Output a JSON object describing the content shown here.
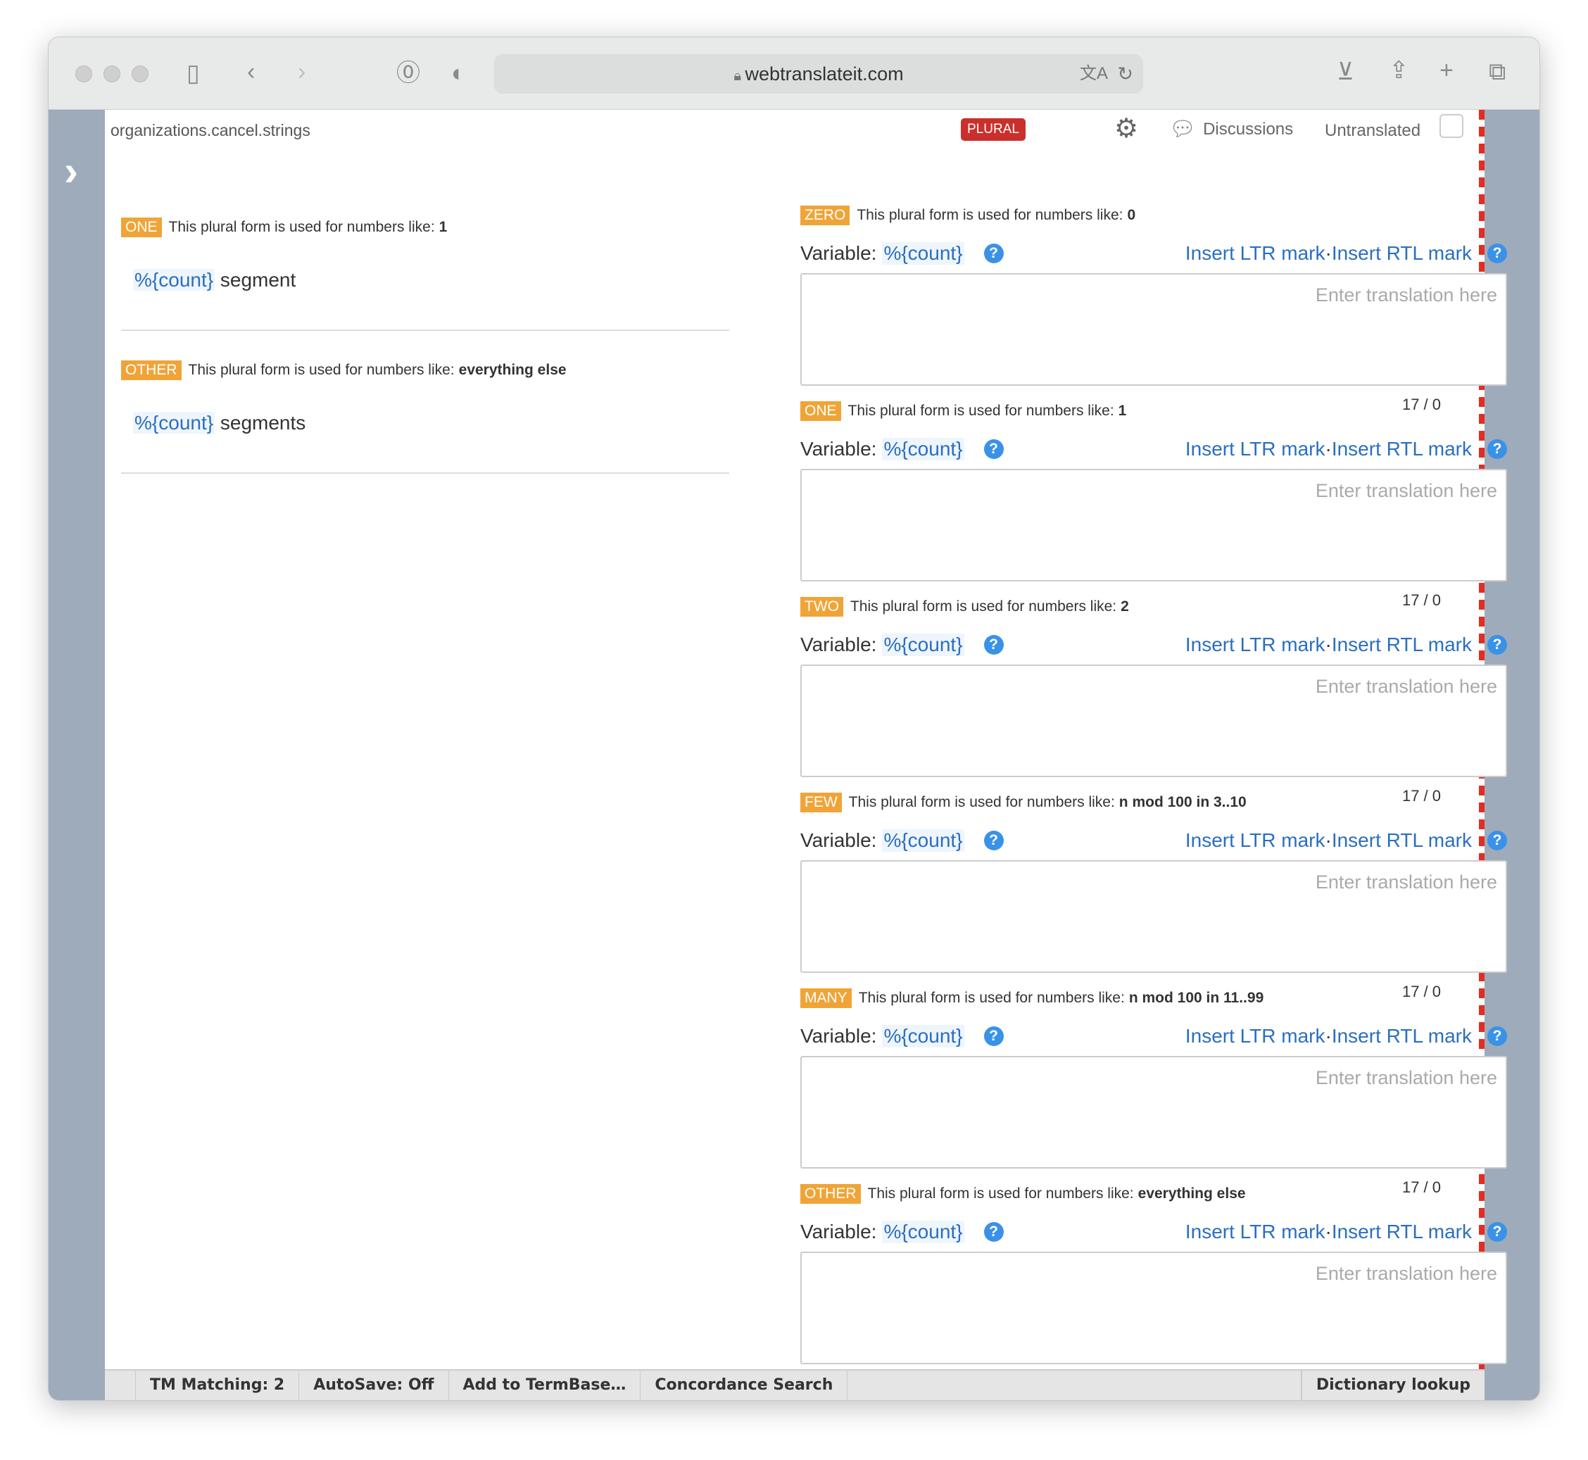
{
  "browser": {
    "url": "webtranslateit.com"
  },
  "header": {
    "key": "organizations.cancel.strings",
    "type_badge": "PLURAL",
    "discussions": "Discussions",
    "untranslated": "Untranslated"
  },
  "source": [
    {
      "form": "ONE",
      "desc": "This plural form is used for numbers like:",
      "example": "1",
      "variable": "%{count}",
      "text": " segment"
    },
    {
      "form": "OTHER",
      "desc": "This plural form is used for numbers like:",
      "example": "everything else",
      "variable": "%{count}",
      "text": " segments"
    }
  ],
  "target_common": {
    "variable_label": "Variable:",
    "variable": "%{count}",
    "ltr": "Insert LTR mark",
    "sep": " · ",
    "rtl": "Insert RTL mark",
    "placeholder": "Enter translation here",
    "help": "?"
  },
  "target": [
    {
      "form": "ZERO",
      "desc": "This plural form is used for numbers like:",
      "example": "0",
      "count": "17 / 0"
    },
    {
      "form": "ONE",
      "desc": "This plural form is used for numbers like:",
      "example": "1",
      "count": "17 / 0"
    },
    {
      "form": "TWO",
      "desc": "This plural form is used for numbers like:",
      "example": "2",
      "count": "17 / 0"
    },
    {
      "form": "FEW",
      "desc": "This plural form is used for numbers like:",
      "example": "n mod 100 in 3..10",
      "count": "17 / 0"
    },
    {
      "form": "MANY",
      "desc": "This plural form is used for numbers like:",
      "example": "n mod 100 in 11..99",
      "count": "17 / 0"
    },
    {
      "form": "OTHER",
      "desc": "This plural form is used for numbers like:",
      "example": "everything else",
      "count": "17 / 0"
    }
  ],
  "statusbar": {
    "tm": "TM Matching: 2",
    "autosave": "AutoSave: Off",
    "termbase": "Add to TermBase…",
    "concordance": "Concordance Search",
    "dictionary": "Dictionary lookup"
  },
  "colors": {
    "badge": "#f0a437",
    "plural": "#c9302c",
    "link": "#2a6fc0",
    "dashed": "#e62b21"
  }
}
